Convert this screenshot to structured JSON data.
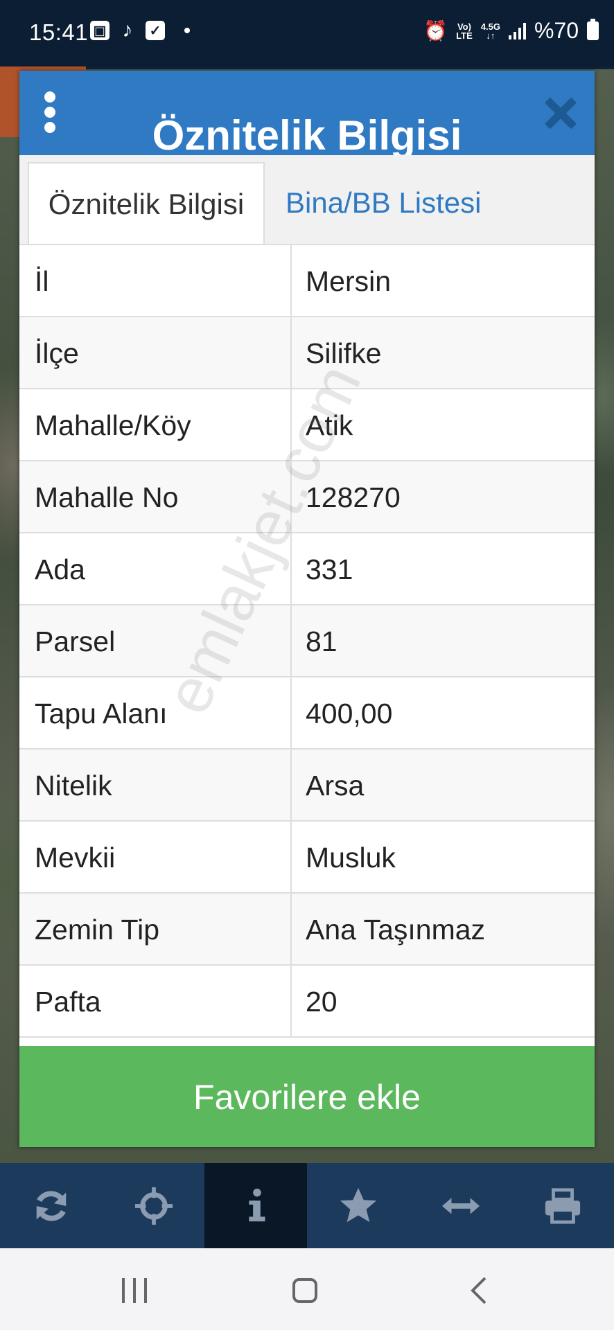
{
  "status_bar": {
    "time": "15:41",
    "network_top": "Vo)",
    "network_bottom": "LTE",
    "net_speed": "4.5G",
    "battery": "%70"
  },
  "dialog": {
    "title": "Öznitelik Bilgisi",
    "tabs": [
      {
        "label": "Öznitelik Bilgisi",
        "active": true
      },
      {
        "label": "Bina/BB Listesi",
        "active": false
      }
    ],
    "rows": [
      {
        "key": "İl",
        "value": "Mersin"
      },
      {
        "key": "İlçe",
        "value": "Silifke"
      },
      {
        "key": "Mahalle/Köy",
        "value": "Atik"
      },
      {
        "key": "Mahalle No",
        "value": "128270"
      },
      {
        "key": "Ada",
        "value": "331"
      },
      {
        "key": "Parsel",
        "value": "81"
      },
      {
        "key": "Tapu Alanı",
        "value": "400,00"
      },
      {
        "key": "Nitelik",
        "value": "Arsa"
      },
      {
        "key": "Mevkii",
        "value": "Musluk"
      },
      {
        "key": "Zemin Tip",
        "value": "Ana Taşınmaz"
      },
      {
        "key": "Pafta",
        "value": "20"
      }
    ],
    "favorite_label": "Favorilere ekle",
    "watermark": "emlakjet.com"
  },
  "toolbar": {
    "items": [
      "refresh-icon",
      "crosshair-icon",
      "info-icon",
      "star-icon",
      "measure-icon",
      "print-icon"
    ],
    "active_index": 2
  },
  "colors": {
    "header_blue": "#2f7ac2",
    "button_green": "#5cb85c",
    "toolbar_blue": "#1b3a5c"
  }
}
